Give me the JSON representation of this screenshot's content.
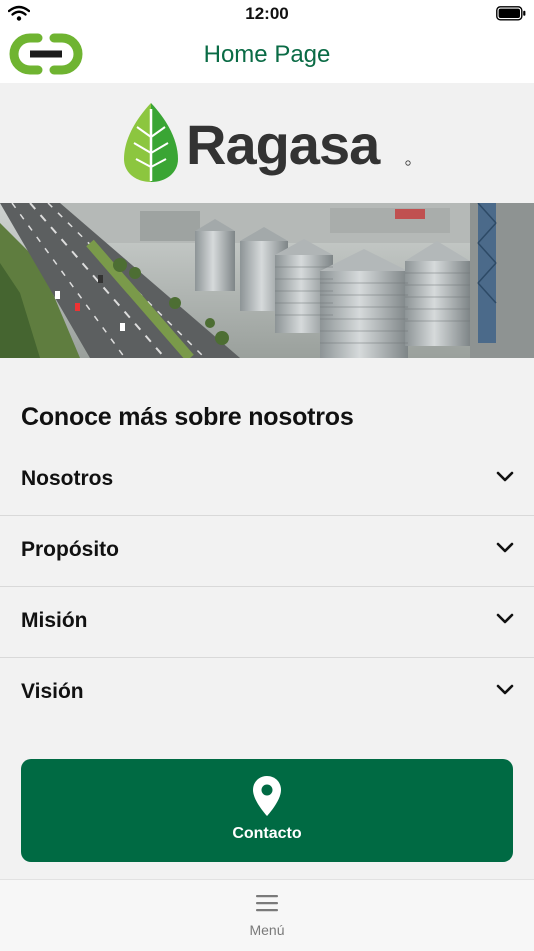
{
  "status_bar": {
    "time": "12:00"
  },
  "nav": {
    "title": "Home Page"
  },
  "brand": {
    "name": "Ragasa"
  },
  "section": {
    "heading": "Conoce más sobre nosotros"
  },
  "accordion": {
    "items": [
      {
        "label": "Nosotros"
      },
      {
        "label": "Propósito"
      },
      {
        "label": "Misión"
      },
      {
        "label": "Visión"
      }
    ]
  },
  "contact": {
    "label": "Contacto",
    "icon": "map-pin-icon"
  },
  "tabbar": {
    "menu_label": "Menú",
    "icon": "hamburger-icon"
  },
  "colors": {
    "accent": "#006a43",
    "title_green": "#0a6b45",
    "logo_green": "#6fb431"
  }
}
